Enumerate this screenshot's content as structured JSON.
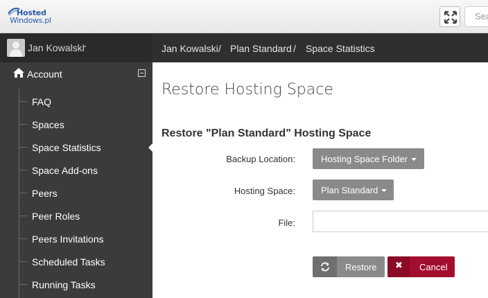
{
  "header": {
    "logo_line1": "Hosted",
    "logo_line2": "Windows.pl",
    "search_placeholder": "Sea",
    "fullscreen_icon": "expand-arrows-icon"
  },
  "sidebar": {
    "user_name": "Jan Kowalski",
    "user_chevron": "⌄",
    "section_label": "Account",
    "section_icon": "home-icon",
    "items": [
      {
        "label": "FAQ"
      },
      {
        "label": "Spaces"
      },
      {
        "label": "Space Statistics",
        "active": true
      },
      {
        "label": "Space Add-ons"
      },
      {
        "label": "Peers"
      },
      {
        "label": "Peer Roles"
      },
      {
        "label": "Peers Invitations"
      },
      {
        "label": "Scheduled Tasks"
      },
      {
        "label": "Running Tasks"
      }
    ]
  },
  "breadcrumb": {
    "items": [
      "Jan Kowalski",
      "Plan Standard",
      "Space Statistics"
    ],
    "separator": "/"
  },
  "main": {
    "page_title": "Restore Hosting Space",
    "form_title": "Restore \"Plan Standard\" Hosting Space",
    "backup_location_label": "Backup Location:",
    "backup_location_value": "Hosting Space Folder",
    "hosting_space_label": "Hosting Space:",
    "hosting_space_value": "Plan Standard",
    "file_label": "File:",
    "file_value": "",
    "restore_label": "Restore",
    "cancel_label": "Cancel",
    "cancel_icon_glyph": "✖"
  },
  "colors": {
    "sidebar_bg": "#3b3b3b",
    "userbar_bg": "#2a2a2a",
    "breadcrumb_bg": "#2f2f2f",
    "button_gray": "#8a8a8a",
    "button_danger": "#a30d2e",
    "brand_blue": "#2a5ca8"
  }
}
